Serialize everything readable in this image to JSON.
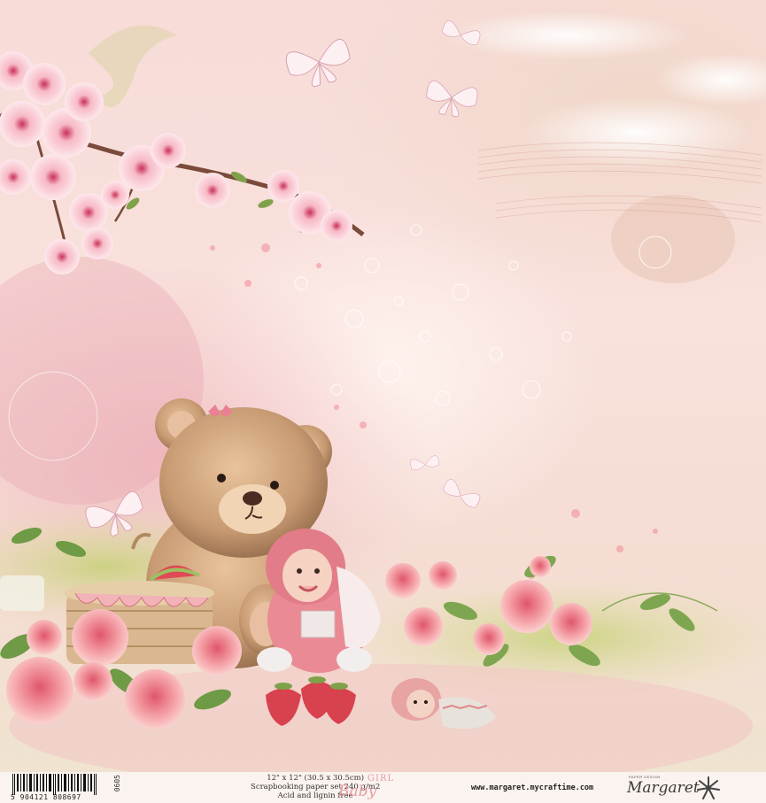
{
  "footer": {
    "barcode_number": "5 904121 808697",
    "sku": "0605",
    "specs": [
      "12\" x 12\" (30.5 x 30.5cm)",
      "Scrapbooking paper set 240 g/m2",
      "Acid and lignin free"
    ],
    "title_word_1": "Baby",
    "title_word_2": "GIRL",
    "website": "www.margaret.mycraftime.com",
    "brand_tagline": "PAPER DESIGN",
    "brand_name": "Margaret"
  },
  "colors": {
    "background_pink": "#f7dcd8",
    "title_pink": "#e59aa2",
    "bear_brown": "#c79a72",
    "rose_pink": "#f29aa0",
    "leaf_green": "#8fb060"
  }
}
